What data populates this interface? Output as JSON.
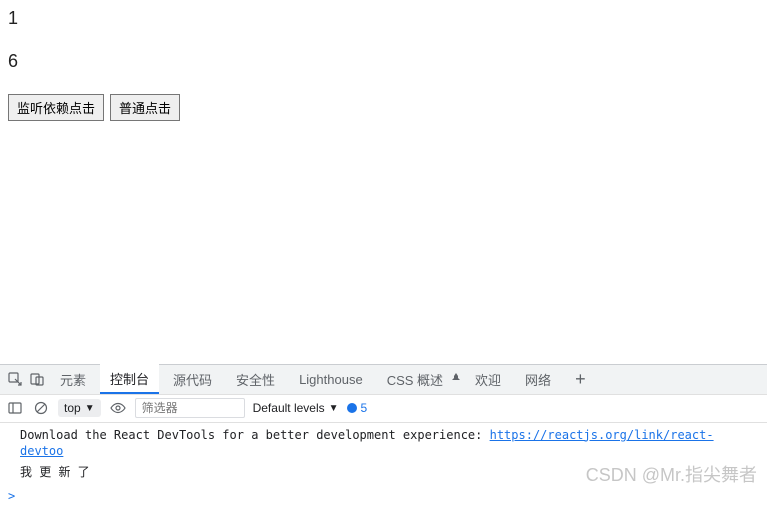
{
  "page": {
    "value1": "1",
    "value2": "6",
    "buttons": {
      "listen": "监听依赖点击",
      "normal": "普通点击"
    }
  },
  "devtools": {
    "tabs": {
      "elements": "元素",
      "console": "控制台",
      "sources": "源代码",
      "security": "安全性",
      "lighthouse": "Lighthouse",
      "css_overview": "CSS 概述",
      "welcome": "欢迎",
      "network": "网络"
    },
    "toolbar": {
      "context": "top",
      "filter_placeholder": "筛选器",
      "levels": "Default levels",
      "issues_count": "5"
    },
    "console": {
      "log1_prefix": "Download the React DevTools for a better development experience: ",
      "log1_link": "https://reactjs.org/link/react-devtoo",
      "log2": "我 更 新 了",
      "prompt": ">"
    }
  },
  "watermark": "CSDN @Mr.指尖舞者"
}
